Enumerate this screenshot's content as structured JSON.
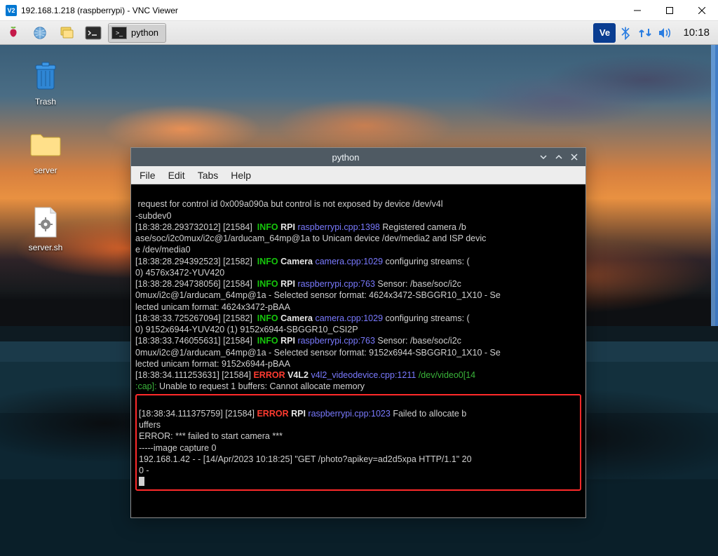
{
  "window": {
    "title": "192.168.1.218 (raspberrypi) - VNC Viewer",
    "app_icon_label": "V2"
  },
  "taskbar": {
    "task_label": "python",
    "clock": "10:18",
    "icons": {
      "menu": "menu-icon",
      "globe": "globe-icon",
      "files": "files-icon",
      "term": "terminal-icon",
      "vnc": "Ve",
      "bt": "bluetooth-icon",
      "net": "network-icon",
      "audio": "audio-icon"
    }
  },
  "desktop_icons": {
    "trash": "Trash",
    "folder": "server",
    "file": "server.sh"
  },
  "terminal": {
    "title": "python",
    "menu": {
      "file": "File",
      "edit": "Edit",
      "tabs": "Tabs",
      "help": "Help"
    },
    "lines": {
      "l0": " request for control id 0x009a090a but control is not exposed by device /dev/v4l",
      "l1": "-subdev0",
      "l2a": "[18:38:28.293732012] [21584]  ",
      "l2b": "INFO",
      "l2c": " RPI ",
      "l2d": "raspberrypi.cpp:1398",
      "l2e": " Registered camera /b",
      "l3": "ase/soc/i2c0mux/i2c@1/arducam_64mp@1a to Unicam device /dev/media2 and ISP devic",
      "l4": "e /dev/media0",
      "l5a": "[18:38:28.294392523] [21582]  ",
      "l5b": "INFO",
      "l5c": " Camera ",
      "l5d": "camera.cpp:1029",
      "l5e": " configuring streams: (",
      "l6": "0) 4576x3472-YUV420",
      "l7a": "[18:38:28.294738056] [21584]  ",
      "l7b": "INFO",
      "l7c": " RPI ",
      "l7d": "raspberrypi.cpp:763",
      "l7e": " Sensor: /base/soc/i2c",
      "l8": "0mux/i2c@1/arducam_64mp@1a - Selected sensor format: 4624x3472-SBGGR10_1X10 - Se",
      "l9": "lected unicam format: 4624x3472-pBAA",
      "l10a": "[18:38:33.725267094] [21582]  ",
      "l10b": "INFO",
      "l10c": " Camera ",
      "l10d": "camera.cpp:1029",
      "l10e": " configuring streams: (",
      "l11": "0) 9152x6944-YUV420 (1) 9152x6944-SBGGR10_CSI2P",
      "l12a": "[18:38:33.746055631] [21584]  ",
      "l12b": "INFO",
      "l12c": " RPI ",
      "l12d": "raspberrypi.cpp:763",
      "l12e": " Sensor: /base/soc/i2c",
      "l13": "0mux/i2c@1/arducam_64mp@1a - Selected sensor format: 9152x6944-SBGGR10_1X10 - Se",
      "l14": "lected unicam format: 9152x6944-pBAA",
      "l15a": "[18:38:34.111253631] [21584] ",
      "l15b": "ERROR",
      "l15c": " V4L2 ",
      "l15d": "v4l2_videodevice.cpp:1211",
      "l15e": " ",
      "l15f": "/dev/video0[14",
      "l16a": ":cap]:",
      "l16b": " Unable to request 1 buffers: Cannot allocate memory",
      "hl0a": "[18:38:34.111375759] [21584] ",
      "hl0b": "ERROR",
      "hl0c": " RPI ",
      "hl0d": "raspberrypi.cpp:1023",
      "hl0e": " Failed to allocate b",
      "hl1": "uffers",
      "hl2": "ERROR: *** failed to start camera ***",
      "hl3": "-----image capture 0",
      "hl4": "192.168.1.42 - - [14/Apr/2023 10:18:25] \"GET /photo?apikey=ad2d5xpa HTTP/1.1\" 20",
      "hl5": "0 -"
    }
  }
}
